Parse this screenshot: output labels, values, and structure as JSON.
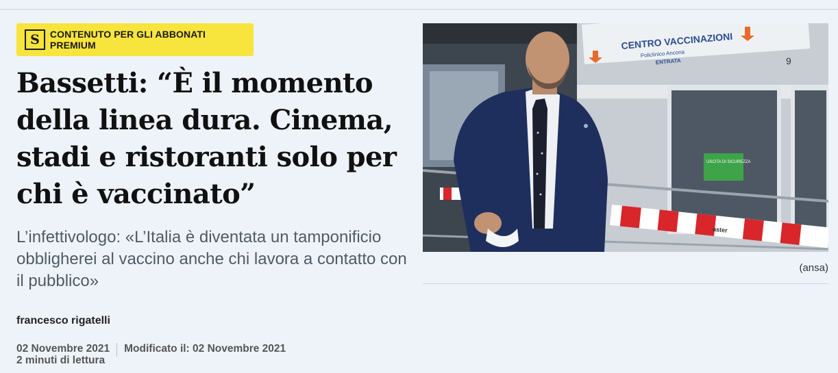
{
  "badge": {
    "logo_letter": "S",
    "label": "CONTENUTO PER GLI ABBONATI PREMIUM"
  },
  "article": {
    "headline": "Bassetti: “È il momento della linea dura. Cinema, stadi e ristoranti solo per chi è vaccinato”",
    "subtitle": "L’infettivologo: «L’Italia è diventata un tamponificio obbligherei al vaccino anche chi lavora a contatto con il pubblico»",
    "author": "francesco rigatelli",
    "published": "02 Novembre 2021",
    "modified": "Modificato il: 02 Novembre 2021",
    "reading_time": "2 minuti di lettura"
  },
  "photo": {
    "caption": "(ansa)",
    "sign_title": "CENTRO VACCINAZIONI",
    "sign_sub": "Policlinico Ancona",
    "sign_entry": "ENTRATA",
    "sign_number": "9",
    "green_sign": "USCITA DI SICUREZZA",
    "barrier_text": "aster"
  },
  "colors": {
    "background": "#eef3f9",
    "badge": "#f7e43c",
    "headline": "#111111",
    "subtitle": "#4f5b66"
  }
}
